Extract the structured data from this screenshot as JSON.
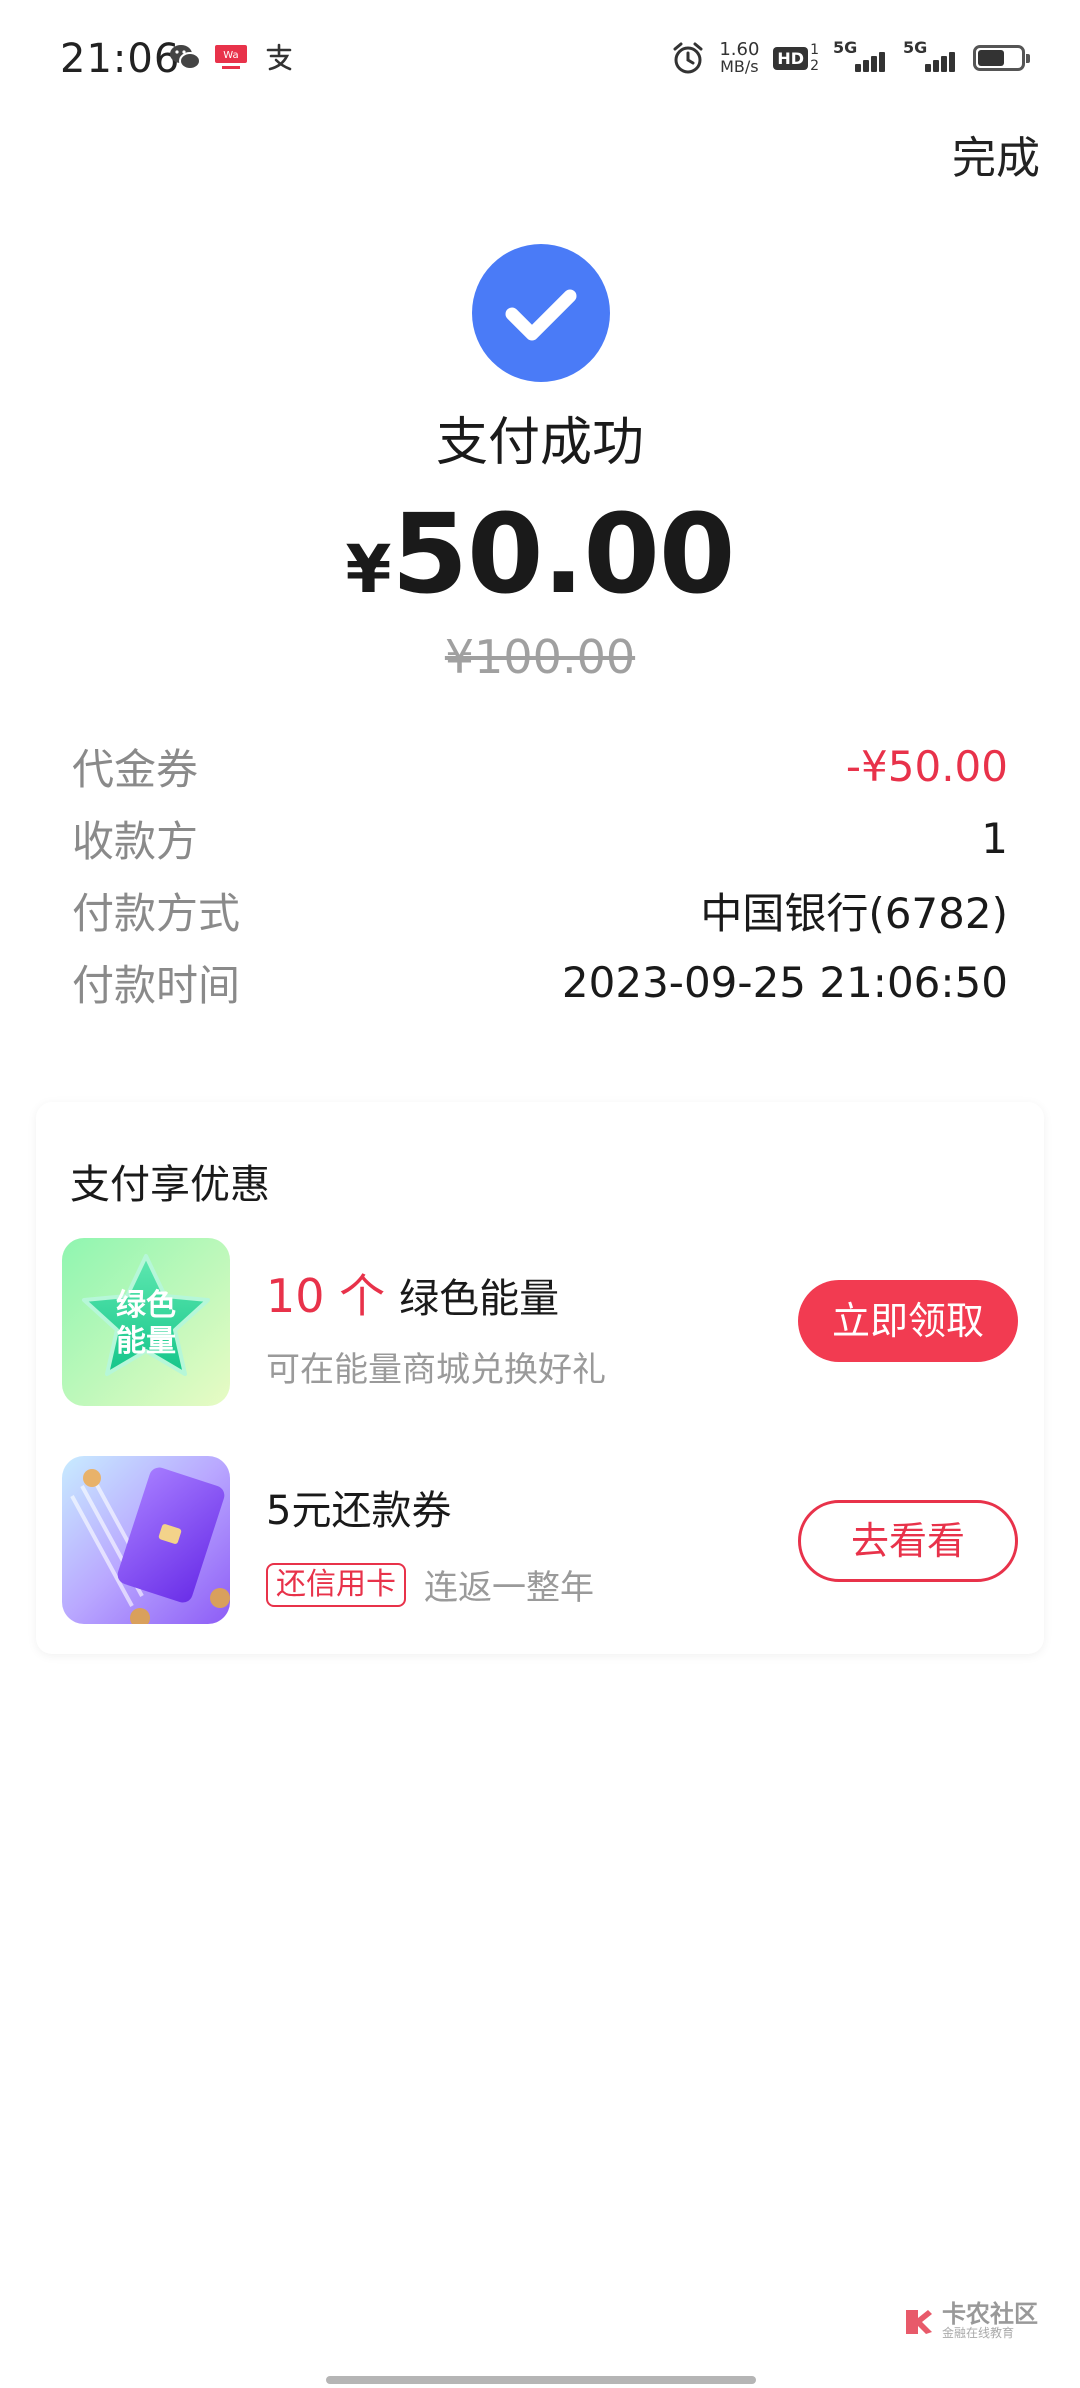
{
  "status_bar": {
    "time": "21:06",
    "net_speed_value": "1.60",
    "net_speed_unit": "MB/s",
    "hd_label": "HD",
    "hd_sub_top": "1",
    "hd_sub_bottom": "2",
    "sim1_label": "5G",
    "sim2_label": "5G",
    "app_icons": [
      "wechat-icon",
      "weibo-icon",
      "alipay-icon"
    ],
    "alarm_icon": "alarm-icon"
  },
  "header": {
    "done_label": "完成"
  },
  "payment": {
    "status_icon": "checkmark-icon",
    "status_text": "支付成功",
    "currency": "¥",
    "amount": "50.00",
    "original_amount": "¥100.00"
  },
  "details": [
    {
      "label": "代金券",
      "value": "-¥50.00"
    },
    {
      "label": "收款方",
      "value": "1"
    },
    {
      "label": "付款方式",
      "value": "中国银行(6782)"
    },
    {
      "label": "付款时间",
      "value": "2023-09-25 21:06:50"
    }
  ],
  "promo": {
    "title": "支付享优惠",
    "items": [
      {
        "thumb_icon": "green-energy-star-icon",
        "thumb_text_line1": "绿色",
        "thumb_text_line2": "能量",
        "count": "10 个",
        "name": "绿色能量",
        "subtitle": "可在能量商城兑换好礼",
        "button": "立即领取"
      },
      {
        "thumb_icon": "credit-card-icon",
        "name": "5元还款券",
        "tag": "还信用卡",
        "subtitle": "连返一整年",
        "button": "去看看"
      }
    ]
  },
  "watermark": {
    "text": "卡农社区",
    "sub": "金融在线教育"
  },
  "colors": {
    "accent_blue": "#4a7bf7",
    "accent_red": "#e8324a",
    "button_red": "#f23b51"
  }
}
